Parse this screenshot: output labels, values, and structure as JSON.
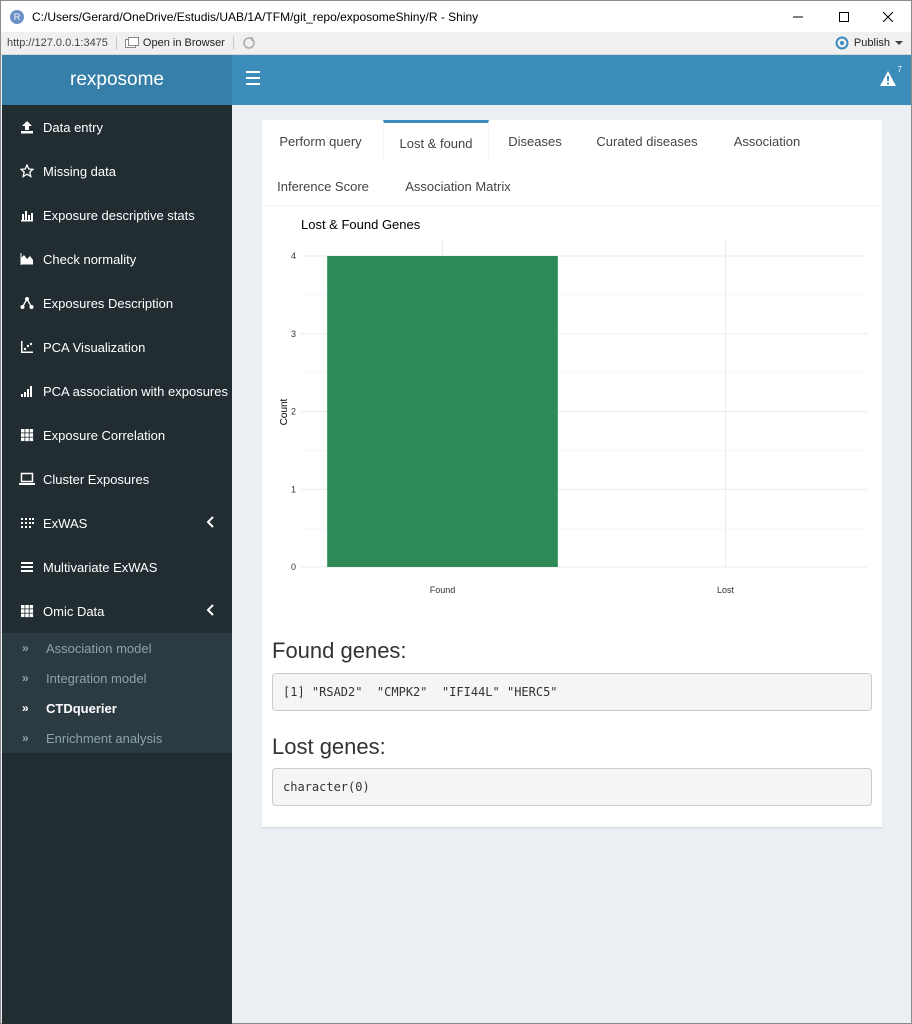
{
  "window": {
    "title": "C:/Users/Gerard/OneDrive/Estudis/UAB/1A/TFM/git_repo/exposomeShiny/R - Shiny",
    "r_logo_letter": "R"
  },
  "toolbar": {
    "url": "http://127.0.0.1:3475",
    "open_browser": "Open in Browser",
    "publish": "Publish"
  },
  "header": {
    "brand": "rexposome",
    "alert_count": "7"
  },
  "sidebar": {
    "items": [
      {
        "label": "Data entry",
        "icon": "upload-icon"
      },
      {
        "label": "Missing data",
        "icon": "star-icon"
      },
      {
        "label": "Exposure descriptive stats",
        "icon": "bar-chart-icon"
      },
      {
        "label": "Check normality",
        "icon": "area-chart-icon"
      },
      {
        "label": "Exposures Description",
        "icon": "network-icon"
      },
      {
        "label": "PCA Visualization",
        "icon": "scatter-icon"
      },
      {
        "label": "PCA association with exposures",
        "icon": "signal-icon"
      },
      {
        "label": "Exposure Correlation",
        "icon": "grid-icon"
      },
      {
        "label": "Cluster Exposures",
        "icon": "laptop-icon"
      },
      {
        "label": "ExWAS",
        "icon": "dots-grid-icon"
      },
      {
        "label": "Multivariate ExWAS",
        "icon": "list-icon"
      },
      {
        "label": "Omic Data",
        "icon": "grid-icon"
      }
    ],
    "submenu": [
      {
        "label": "Association model"
      },
      {
        "label": "Integration model"
      },
      {
        "label": "CTDquerier"
      },
      {
        "label": "Enrichment analysis"
      }
    ]
  },
  "tabs": [
    {
      "label": "Perform query"
    },
    {
      "label": "Lost & found"
    },
    {
      "label": "Diseases"
    },
    {
      "label": "Curated diseases"
    },
    {
      "label": "Association"
    },
    {
      "label": "Inference Score"
    },
    {
      "label": "Association Matrix"
    }
  ],
  "chart_data": {
    "type": "bar",
    "title": "Lost & Found Genes",
    "xlabel": "",
    "ylabel": "Count",
    "categories": [
      "Found",
      "Lost"
    ],
    "values": [
      4,
      0
    ],
    "ylim": [
      0,
      4
    ],
    "yticks": [
      "0",
      "1",
      "2",
      "3",
      "4"
    ],
    "bar_color": "#2e8b57",
    "grid": true
  },
  "found": {
    "heading": "Found genes:",
    "output": "[1] \"RSAD2\"  \"CMPK2\"  \"IFI44L\" \"HERC5\""
  },
  "lost": {
    "heading": "Lost genes:",
    "output": "character(0)"
  },
  "colors": {
    "header": "#3c8dbc",
    "logo": "#367fa9",
    "sidebar": "#222d32",
    "submenu": "#2c3b41",
    "content_bg": "#ecf0f5"
  }
}
